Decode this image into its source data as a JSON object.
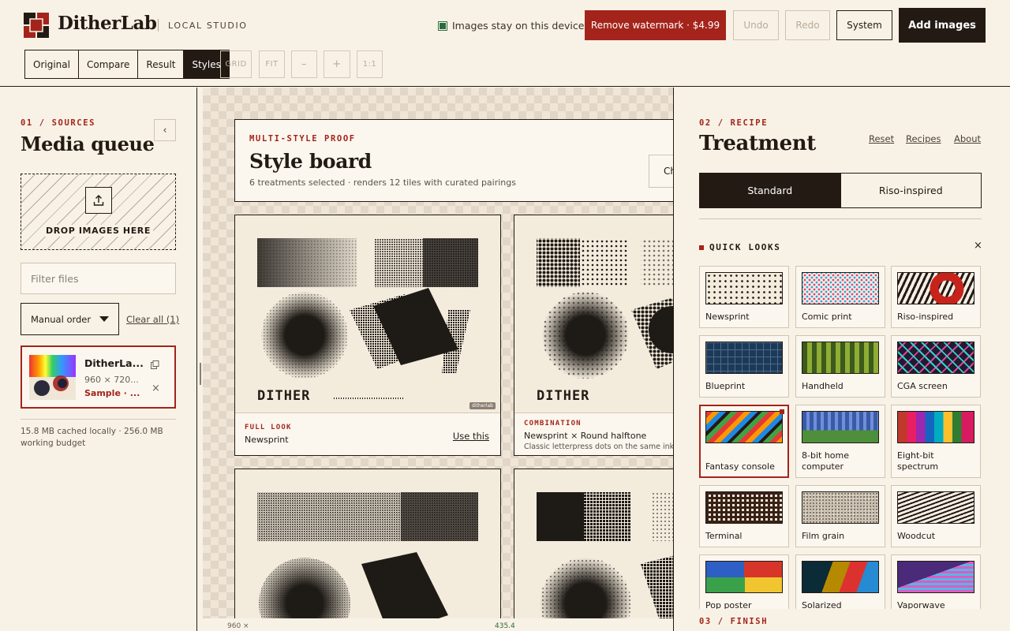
{
  "app": {
    "name": "DitherLab",
    "tag": "LOCAL STUDIO",
    "privacy": "Images stay on this device"
  },
  "toolbar": {
    "watermark": "Remove watermark · $4.99",
    "undo": "Undo",
    "redo": "Redo",
    "system": "System",
    "add_images": "Add images"
  },
  "views": [
    "Original",
    "Compare",
    "Result",
    "Styles"
  ],
  "active_view": "Styles",
  "zoom_tools": [
    "GRID",
    "FIT",
    "–",
    "+",
    "1:1"
  ],
  "sources": {
    "eyebrow": "01 / SOURCES",
    "title": "Media queue",
    "drop_label": "DROP IMAGES HERE",
    "filter_placeholder": "Filter files",
    "order": "Manual order",
    "clear": "Clear all (1)",
    "item": {
      "name": "DitherLa...",
      "dims": "960 × 720...",
      "source": "Sample · ..."
    },
    "cache": "15.8 MB cached locally · 256.0 MB working budget"
  },
  "board": {
    "eyebrow": "MULTI-STYLE PROOF",
    "title": "Style board",
    "sub": "6 treatments selected · renders 12 tiles with curated pairings",
    "button": "Ch",
    "tiles": [
      {
        "kind": "FULL LOOK",
        "name": "Newsprint",
        "desc": "",
        "use": "Use this",
        "art_text": "DITHER",
        "wm": "ditherlab"
      },
      {
        "kind": "COMBINATION",
        "name": "Newsprint × Round halftone",
        "desc": "Classic letterpress dots on the same ink.",
        "use": "",
        "art_text": "DITHER",
        "wm": ""
      }
    ],
    "status_left": "960 ×",
    "status_right": "435.4"
  },
  "recipe": {
    "eyebrow": "02 / RECIPE",
    "title": "Treatment",
    "links": [
      "Reset",
      "Recipes",
      "About"
    ],
    "modes": [
      "Standard",
      "Riso-inspired"
    ],
    "active_mode": "Standard",
    "quick_title": "QUICK LOOKS",
    "close": "×",
    "selected_look": "Fantasy console",
    "looks": [
      {
        "label": "Newsprint",
        "icon": "dots-pattern"
      },
      {
        "label": "Comic print",
        "icon": "cmyk-dots-pattern"
      },
      {
        "label": "Riso-inspired",
        "icon": "riso-stripes-pattern"
      },
      {
        "label": "Blueprint",
        "icon": "grid-pattern"
      },
      {
        "label": "Handheld",
        "icon": "green-checker-pattern"
      },
      {
        "label": "CGA screen",
        "icon": "cga-crosshatch-pattern"
      },
      {
        "label": "Fantasy console",
        "icon": "rainbow-diagonal-pattern"
      },
      {
        "label": "8-bit home computer",
        "icon": "8bit-stripes-pattern"
      },
      {
        "label": "Eight-bit spectrum",
        "icon": "spectrum-bars-pattern"
      },
      {
        "label": "Terminal",
        "icon": "terminal-grid-pattern"
      },
      {
        "label": "Film grain",
        "icon": "grain-pattern"
      },
      {
        "label": "Woodcut",
        "icon": "woodcut-lines-pattern"
      },
      {
        "label": "Pop poster",
        "icon": "pop-blocks-pattern"
      },
      {
        "label": "Solarized",
        "icon": "solarized-bands-pattern"
      },
      {
        "label": "Vaporwave",
        "icon": "vaporwave-pattern"
      }
    ],
    "finish": "03 / FINISH"
  },
  "colors": {
    "accent": "#a4241b",
    "ink": "#231a14",
    "paper": "#f8f2e6",
    "privacy_ok": "#2d6b3a"
  }
}
